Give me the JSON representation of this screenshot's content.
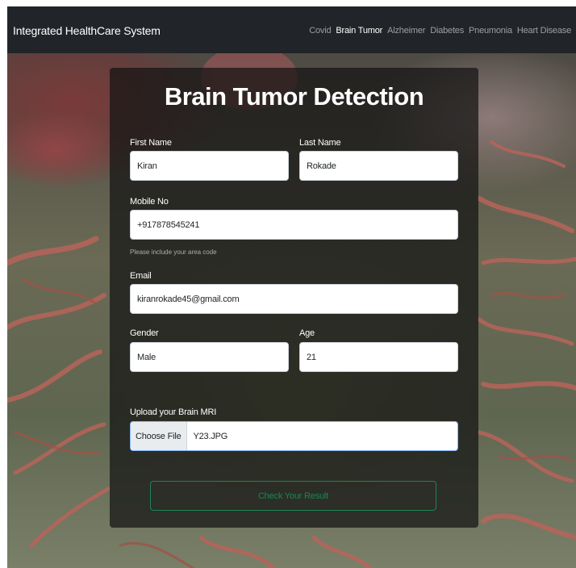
{
  "app": {
    "brand": "Integrated HealthCare System"
  },
  "nav": {
    "items": [
      {
        "label": "Covid",
        "active": false
      },
      {
        "label": "Brain Tumor",
        "active": true
      },
      {
        "label": "Alzheimer",
        "active": false
      },
      {
        "label": "Diabetes",
        "active": false
      },
      {
        "label": "Pneumonia",
        "active": false
      },
      {
        "label": "Heart Disease",
        "active": false
      }
    ]
  },
  "form": {
    "title": "Brain Tumor Detection",
    "first_name": {
      "label": "First Name",
      "value": "Kiran"
    },
    "last_name": {
      "label": "Last Name",
      "value": "Rokade"
    },
    "mobile": {
      "label": "Mobile No",
      "value": "+917878545241",
      "help": "Please include your area code"
    },
    "email": {
      "label": "Email",
      "value": "kiranrokade45@gmail.com"
    },
    "gender": {
      "label": "Gender",
      "value": "Male"
    },
    "age": {
      "label": "Age",
      "value": "21"
    },
    "upload": {
      "label": "Upload your Brain MRI",
      "button": "Choose File",
      "file_name": "Y23.JPG"
    },
    "submit_label": "Check Your Result"
  },
  "colors": {
    "navbar": "#212529",
    "success": "#198754",
    "focus_border": "#86b7fe"
  }
}
